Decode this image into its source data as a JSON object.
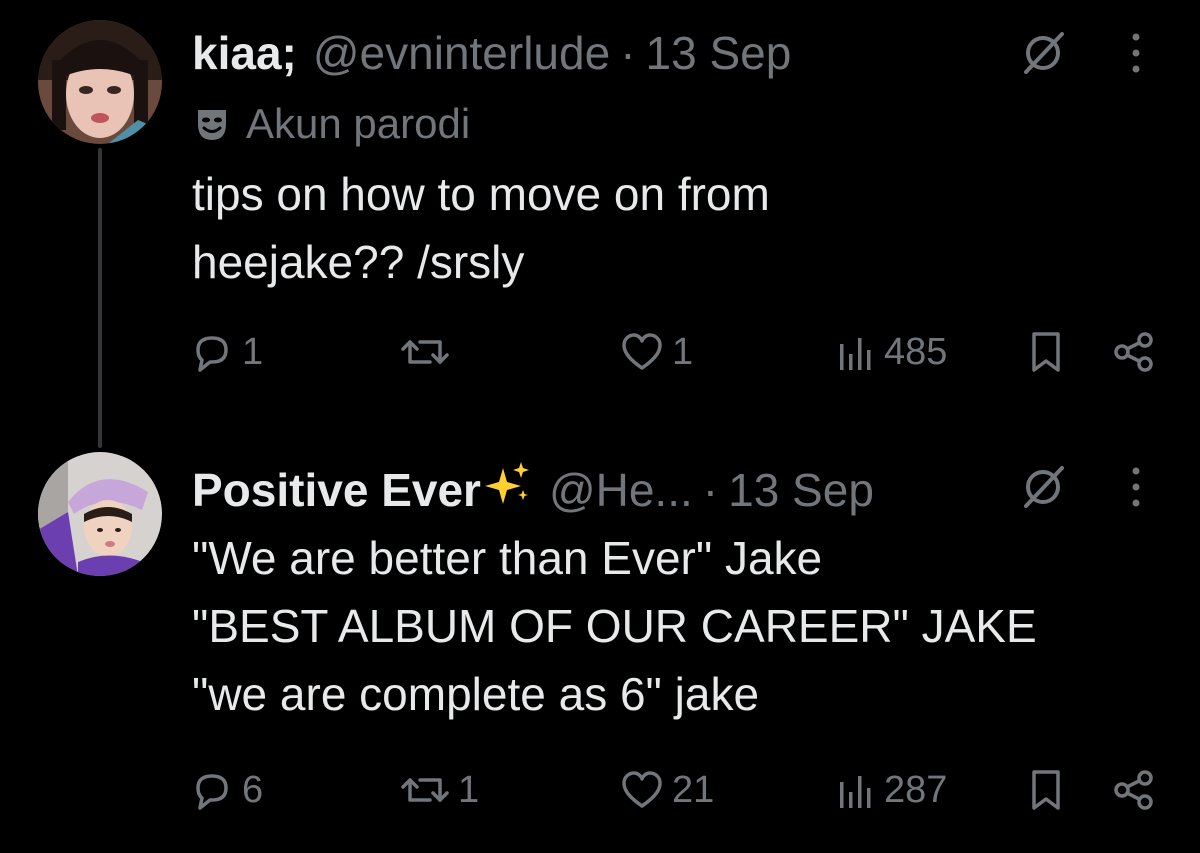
{
  "tweets": [
    {
      "name": "kiaa;",
      "handle": "@evninterlude",
      "separator": "·",
      "date": "13 Sep",
      "badge_text": "Akun parodi",
      "badge_icon": "parody-mask-icon",
      "text": "tips on how to move on from\nheejake?? /srsly",
      "replies": "1",
      "reposts": "",
      "likes": "1",
      "views": "485"
    },
    {
      "name": "Positive Ever",
      "name_emoji": "sparkles-icon",
      "handle": "@He...",
      "separator": "·",
      "date": "13 Sep",
      "text": "\"We are better than Ever\" Jake\n\"BEST ALBUM OF OUR CAREER\" JAKE\n\"we are complete as 6\" jake",
      "replies": "6",
      "reposts": "1",
      "likes": "21",
      "views": "287"
    }
  ],
  "colors": {
    "background": "#000000",
    "text_primary": "#e7e9ea",
    "text_secondary": "#71767b",
    "thread_line": "#333639",
    "sparkle": "#ffd02f"
  }
}
